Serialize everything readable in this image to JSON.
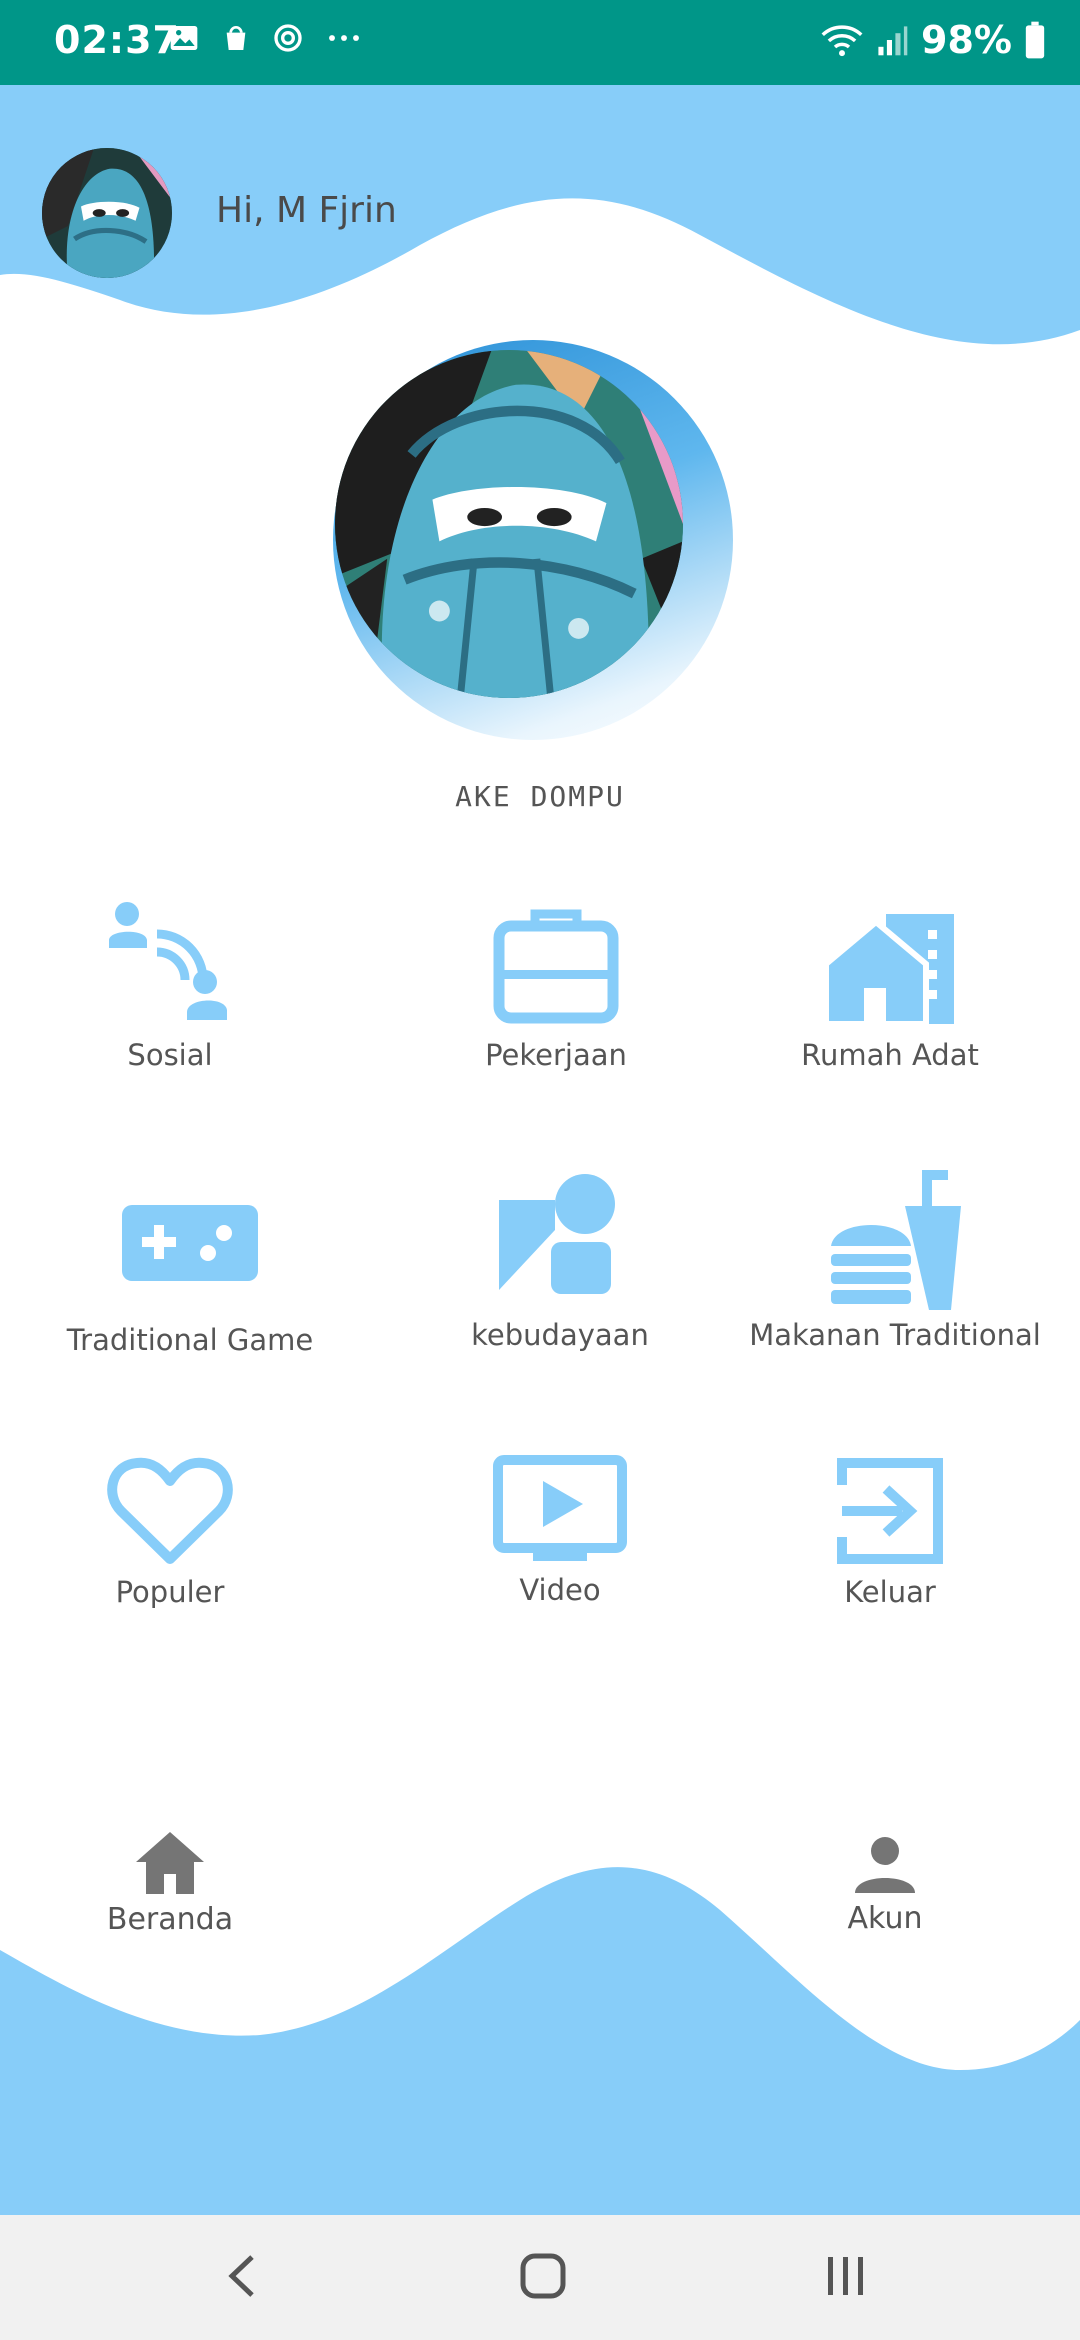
{
  "status_bar": {
    "time": "02:37",
    "icons": [
      "image-icon",
      "bag-icon",
      "sync-icon",
      "more-icon"
    ],
    "battery": "98%",
    "background": "#009688"
  },
  "header": {
    "greeting": "Hi, M Fjrin",
    "wave_color": "#87cdf9"
  },
  "app_title": "AKE DOMPU",
  "menu": {
    "icon_color": "#87cdf9",
    "items": [
      {
        "label": "Sosial",
        "icon": "social-icon"
      },
      {
        "label": "Pekerjaan",
        "icon": "briefcase-icon"
      },
      {
        "label": "Rumah Adat",
        "icon": "house-icon"
      },
      {
        "label": "Traditional Game",
        "icon": "gamepad-icon"
      },
      {
        "label": "kebudayaan",
        "icon": "culture-icon"
      },
      {
        "label": "Makanan Traditional",
        "icon": "food-icon"
      },
      {
        "label": "Populer",
        "icon": "heart-icon"
      },
      {
        "label": "Video",
        "icon": "video-icon"
      },
      {
        "label": "Keluar",
        "icon": "exit-icon"
      }
    ]
  },
  "bottom_nav": {
    "home_label": "Beranda",
    "account_label": "Akun"
  },
  "system_nav": [
    "back",
    "home",
    "recents"
  ]
}
